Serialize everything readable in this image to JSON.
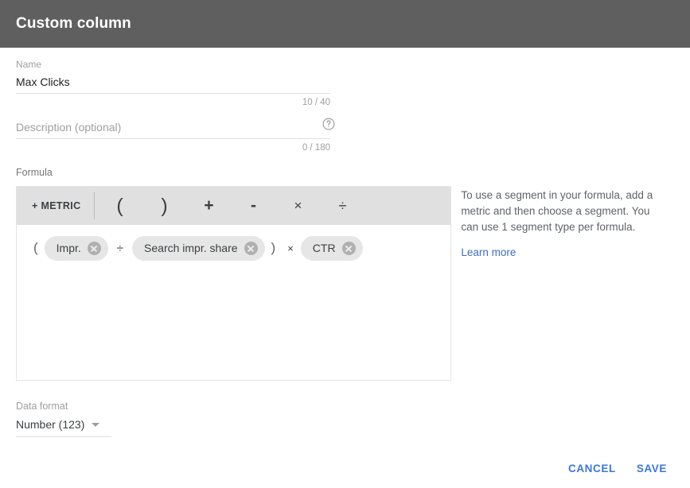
{
  "header": {
    "title": "Custom column"
  },
  "name_field": {
    "label": "Name",
    "value": "Max Clicks",
    "counter": "10 / 40"
  },
  "description_field": {
    "label": "Description (optional)",
    "value": "",
    "placeholder": "Description (optional)",
    "counter": "0 / 180",
    "help_icon": "help-circle-icon"
  },
  "formula": {
    "label": "Formula",
    "toolbar": {
      "metric_button": "+ METRIC",
      "operators": [
        {
          "name": "open-paren",
          "symbol": "("
        },
        {
          "name": "close-paren",
          "symbol": ")"
        },
        {
          "name": "plus",
          "symbol": "+"
        },
        {
          "name": "minus",
          "symbol": "-"
        },
        {
          "name": "multiply",
          "symbol": "×"
        },
        {
          "name": "divide",
          "symbol": "÷"
        }
      ]
    },
    "expression": [
      {
        "type": "operator",
        "text": "("
      },
      {
        "type": "chip",
        "text": "Impr."
      },
      {
        "type": "operator",
        "text": "÷"
      },
      {
        "type": "chip",
        "text": "Search impr. share"
      },
      {
        "type": "operator",
        "text": ")"
      },
      {
        "type": "operator",
        "text": "×"
      },
      {
        "type": "chip",
        "text": "CTR"
      }
    ]
  },
  "help_panel": {
    "text": "To use a segment in your formula, add a metric and then choose a segment. You can use 1 segment type per formula.",
    "link": "Learn more"
  },
  "data_format": {
    "label": "Data format",
    "value": "Number (123)",
    "options": [
      "Number (123)"
    ]
  },
  "footer": {
    "cancel_label": "CANCEL",
    "save_label": "SAVE"
  },
  "colors": {
    "header_bg": "#5f5f5f",
    "toolbar_bg": "#e0e0e0",
    "chip_bg": "#e6e6e6",
    "accent_link": "#3c6ec0",
    "accent_button": "#3c77dd"
  }
}
